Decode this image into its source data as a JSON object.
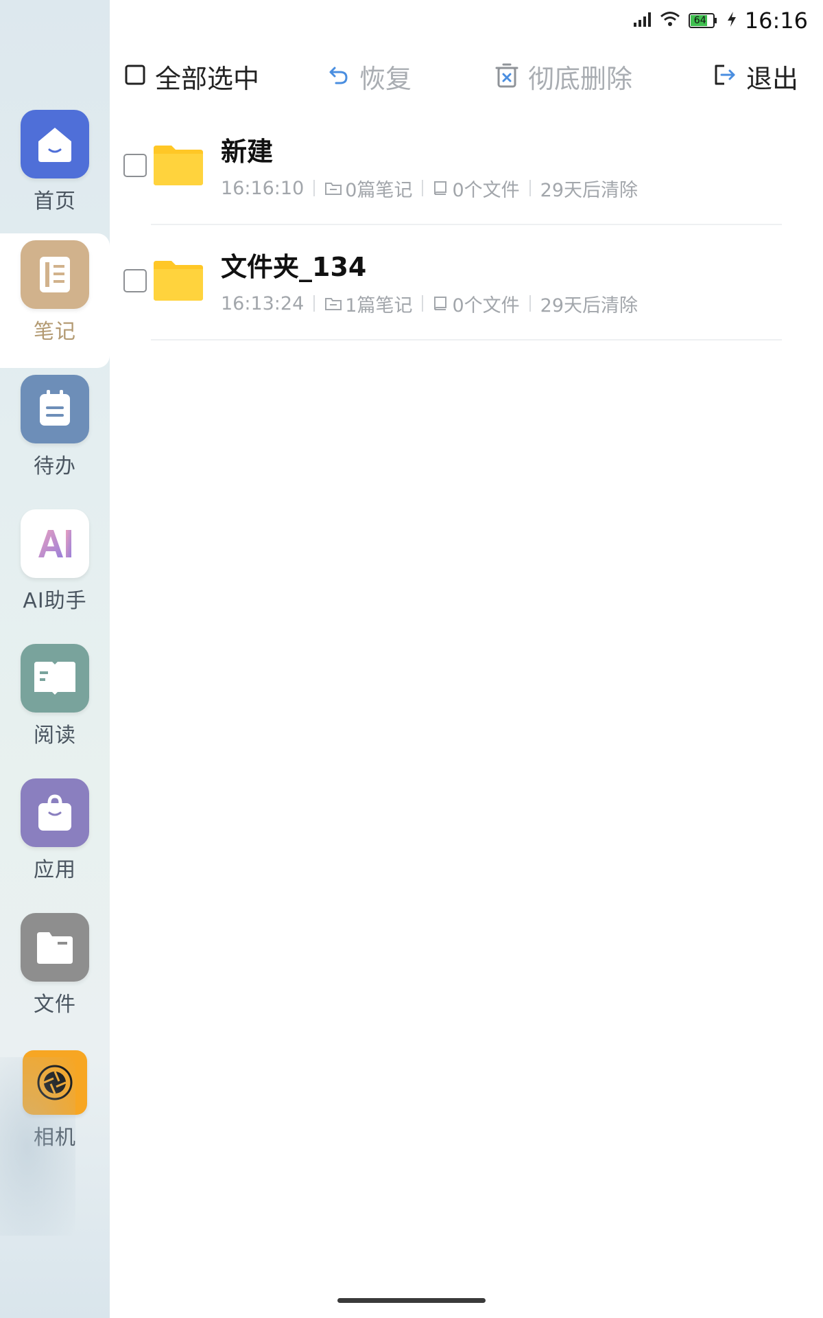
{
  "status_bar": {
    "time": "16:16",
    "battery": "64"
  },
  "toolbar": {
    "select_all": "全部选中",
    "restore": "恢复",
    "delete_permanently": "彻底删除",
    "exit": "退出"
  },
  "sidebar": {
    "items": [
      {
        "label": "首页",
        "icon": "home-icon",
        "color": "#4f6fd8"
      },
      {
        "label": "笔记",
        "icon": "notebook-icon",
        "color": "#d1b28c"
      },
      {
        "label": "待办",
        "icon": "todo-icon",
        "color": "#6d8eb8"
      },
      {
        "label": "AI助手",
        "icon": "ai-icon",
        "color": "#ffffff"
      },
      {
        "label": "阅读",
        "icon": "book-icon",
        "color": "#79a39c"
      },
      {
        "label": "应用",
        "icon": "bag-icon",
        "color": "#8a7fbf"
      },
      {
        "label": "文件",
        "icon": "folder-icon",
        "color": "#8e8e8e"
      },
      {
        "label": "相机",
        "icon": "camera-icon",
        "color": "#f7a623"
      }
    ]
  },
  "folders": [
    {
      "name": "新建",
      "time": "16:16:10",
      "notes": "0篇笔记",
      "files": "0个文件",
      "expire": "29天后清除"
    },
    {
      "name": "文件夹_134",
      "time": "16:13:24",
      "notes": "1篇笔记",
      "files": "0个文件",
      "expire": "29天后清除"
    }
  ],
  "accent_color": "#4a8ee0",
  "folder_color": "#ffc726"
}
